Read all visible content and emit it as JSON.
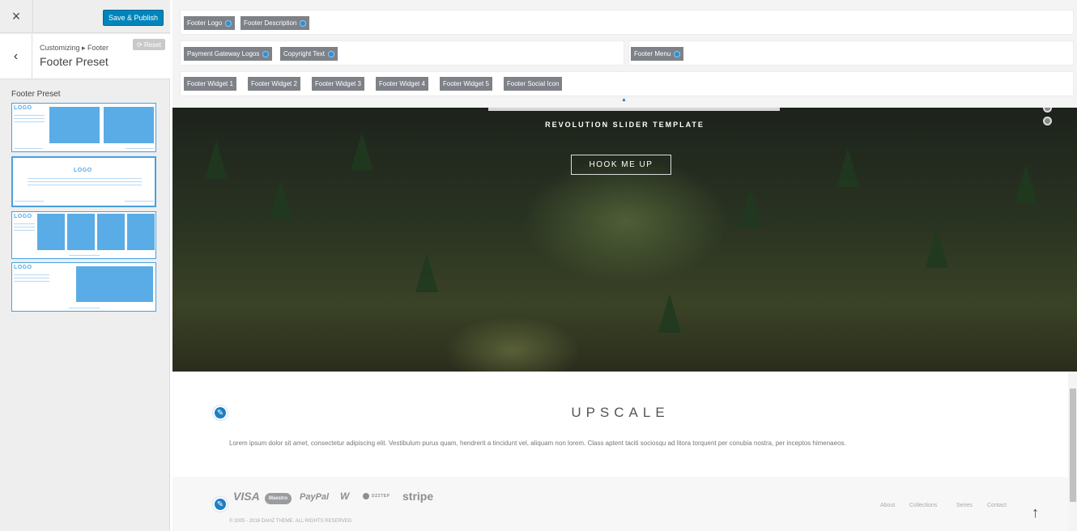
{
  "customizer": {
    "close_icon": "×",
    "save_label": "Save & Publish",
    "back_icon": "‹",
    "breadcrumb": "Customizing ▸ Footer",
    "section_title": "Footer Preset",
    "reset_label": "⟳ Reset",
    "preset_heading": "Footer Preset",
    "presets": [
      {
        "logo": "LOGO"
      },
      {
        "logo": "LOGO"
      },
      {
        "logo": "LOGO"
      },
      {
        "logo": "LOGO"
      }
    ]
  },
  "toolbar": {
    "row1": [
      "Footer Logo",
      "Footer Description"
    ],
    "row2_left": [
      "Payment Gateway Logos",
      "Copyright Text"
    ],
    "row2_right": [
      "Footer Menu"
    ],
    "row3": [
      "Footer Widget 1",
      "Footer Widget 2",
      "Footer Widget 3",
      "Footer Widget 4",
      "Footer Widget 5",
      "Footer Social Icon"
    ]
  },
  "hero": {
    "subtitle": "REVOLUTION SLIDER TEMPLATE",
    "button_label": "HOOK ME UP"
  },
  "content": {
    "title": "UPSCALE",
    "text": "Lorem ipsum dolor sit amet, consectetur adipiscing elit. Vestibulum purus quam, hendrerit a tincidunt vel, aliquam non lorem. Class aptent taciti sociosqu ad litora torquent per conubia nostra, per inceptos himenaeos.",
    "edit_icon": "✎"
  },
  "footer": {
    "payments": [
      "VISA",
      "Maestro",
      "PayPal",
      "W",
      "DZZTEP",
      "stripe"
    ],
    "copyright": "© 2005 - 2016 DAHZ THEME. ALL RIGHTS RESERVED",
    "menu": [
      "About",
      "Collections",
      "Series",
      "Contact"
    ],
    "totop_icon": "↑",
    "edit_icon": "✎"
  },
  "colors": {
    "accent": "#0085ba",
    "preset_blue": "#5aace6",
    "tag_gray": "#7e8288"
  }
}
